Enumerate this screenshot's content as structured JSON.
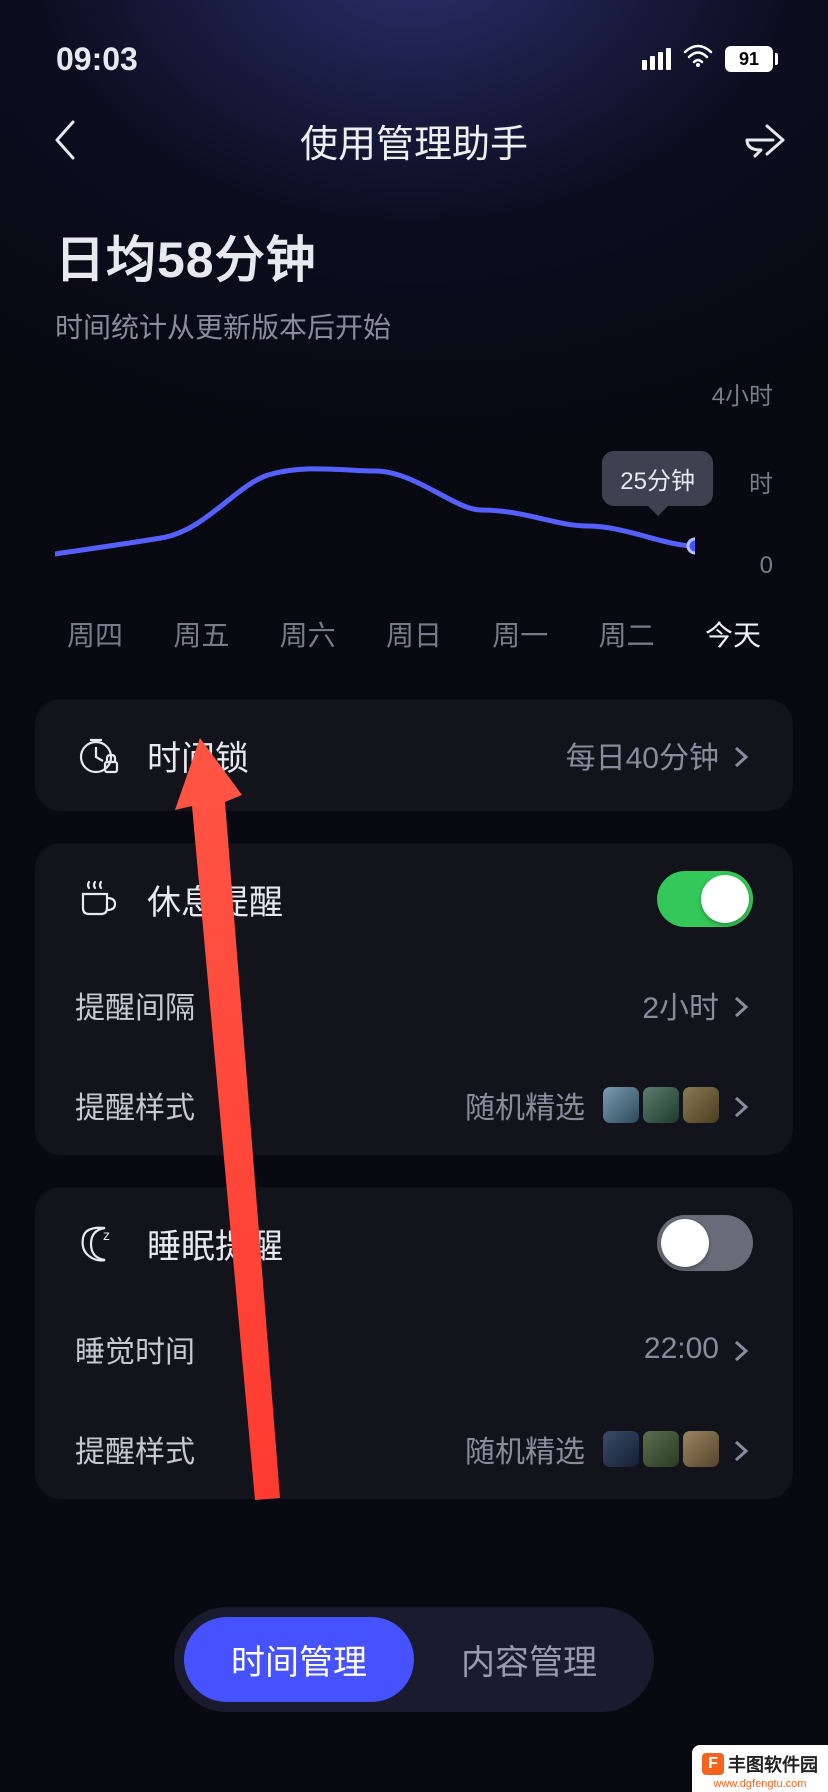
{
  "status": {
    "time": "09:03",
    "battery": "91"
  },
  "header": {
    "title": "使用管理助手"
  },
  "summary": {
    "title": "日均58分钟",
    "subtitle": "时间统计从更新版本后开始"
  },
  "chart_data": {
    "type": "line",
    "categories": [
      "周四",
      "周五",
      "周六",
      "周日",
      "周一",
      "周二",
      "今天"
    ],
    "values_minutes": [
      15,
      35,
      115,
      120,
      70,
      50,
      25
    ],
    "tooltip": "25分钟",
    "ylabels": [
      "4小时",
      "时",
      "0"
    ],
    "ylim_minutes": [
      0,
      240
    ]
  },
  "rows": {
    "timelock": {
      "label": "时间锁",
      "value": "每日40分钟"
    },
    "rest": {
      "label": "休息提醒",
      "on": true,
      "interval": {
        "label": "提醒间隔",
        "value": "2小时"
      },
      "style": {
        "label": "提醒样式",
        "value": "随机精选"
      }
    },
    "sleep": {
      "label": "睡眠提醒",
      "on": false,
      "time": {
        "label": "睡觉时间",
        "value": "22:00"
      },
      "style": {
        "label": "提醒样式",
        "value": "随机精选"
      }
    }
  },
  "tabs": {
    "time": "时间管理",
    "content": "内容管理"
  },
  "watermark": {
    "text": "丰图软件园",
    "url": "www.dgfengtu.com"
  }
}
